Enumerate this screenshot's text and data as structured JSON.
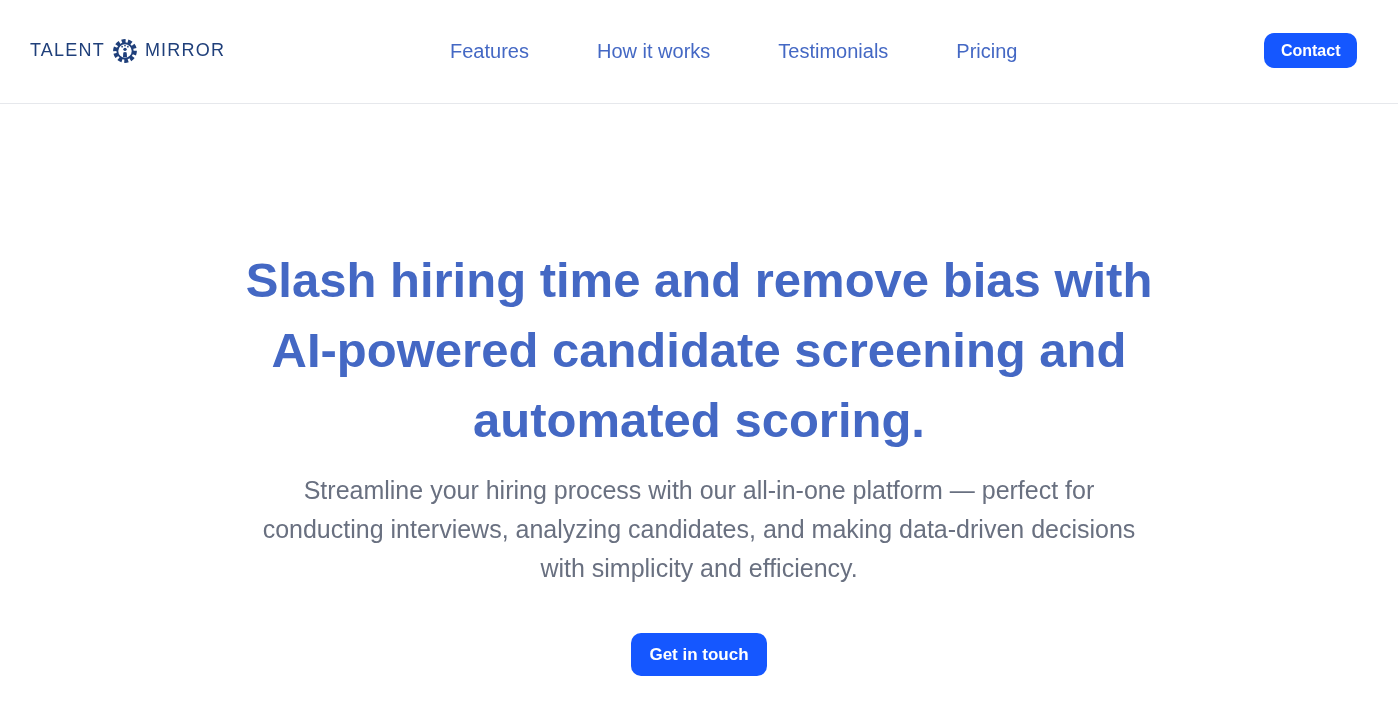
{
  "header": {
    "logo": {
      "left_word": "TALENT",
      "right_word": "MIRROR"
    },
    "nav": [
      "Features",
      "How it works",
      "Testimonials",
      "Pricing"
    ],
    "contact_button": "Contact"
  },
  "hero": {
    "headline": "Slash hiring time and remove bias with **AI-powered** candidate screening and automated scoring.",
    "subtitle": "Streamline your hiring process with our all-in-one platform — perfect for conducting interviews, analyzing candidates, and making data-driven decisions with simplicity and efficiency.",
    "cta_button": "Get in touch"
  }
}
